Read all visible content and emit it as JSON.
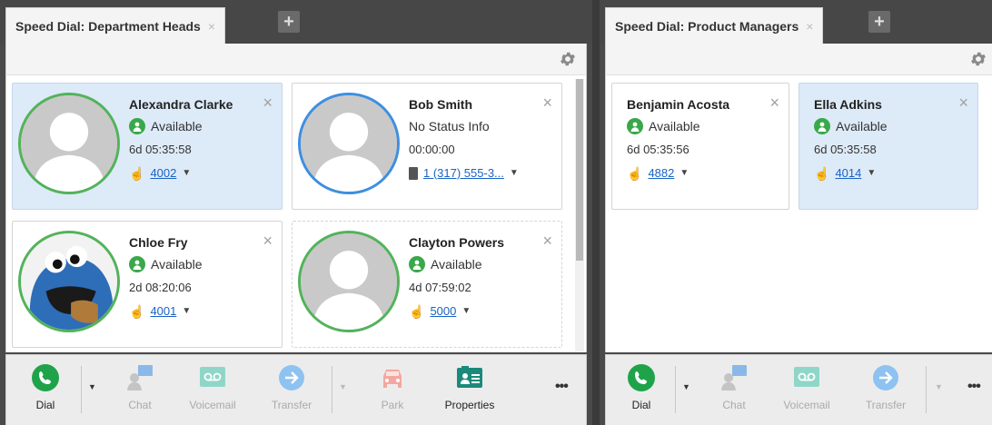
{
  "left_panel": {
    "tab_title": "Speed Dial: Department Heads",
    "tab_close": "×",
    "tab_add": "+",
    "contacts": [
      {
        "name": "Alexandra Clarke",
        "status": "Available",
        "timer": "6d 05:35:58",
        "ext": "4002",
        "avatar": "generic",
        "highlight": true
      },
      {
        "name": "Bob Smith",
        "status": "No Status Info",
        "timer": "00:00:00",
        "ext": "1 (317) 555-3...",
        "avatar": "generic",
        "highlight": false
      },
      {
        "name": "Chloe Fry",
        "status": "Available",
        "timer": "2d 08:20:06",
        "ext": "4001",
        "avatar": "cookie-monster",
        "highlight": false
      },
      {
        "name": "Clayton Powers",
        "status": "Available",
        "timer": "4d 07:59:02",
        "ext": "5000",
        "avatar": "generic",
        "highlight": false
      }
    ],
    "toolbar": {
      "dial": "Dial",
      "chat": "Chat",
      "voicemail": "Voicemail",
      "transfer": "Transfer",
      "park": "Park",
      "properties": "Properties",
      "more": "•••"
    }
  },
  "right_panel": {
    "tab_title": "Speed Dial: Product Managers",
    "tab_close": "×",
    "tab_add": "+",
    "contacts": [
      {
        "name": "Benjamin Acosta",
        "status": "Available",
        "timer": "6d 05:35:56",
        "ext": "4882",
        "highlight": false
      },
      {
        "name": "Ella Adkins",
        "status": "Available",
        "timer": "6d 05:35:58",
        "ext": "4014",
        "highlight": true
      }
    ],
    "toolbar": {
      "dial": "Dial",
      "chat": "Chat",
      "voicemail": "Voicemail",
      "transfer": "Transfer",
      "more": "•••"
    }
  },
  "colors": {
    "available": "#3aa84a",
    "link": "#1a63c4",
    "highlight": "#ddeaf8",
    "dial_green": "#1fa34a",
    "properties_teal": "#1b8a7a"
  }
}
